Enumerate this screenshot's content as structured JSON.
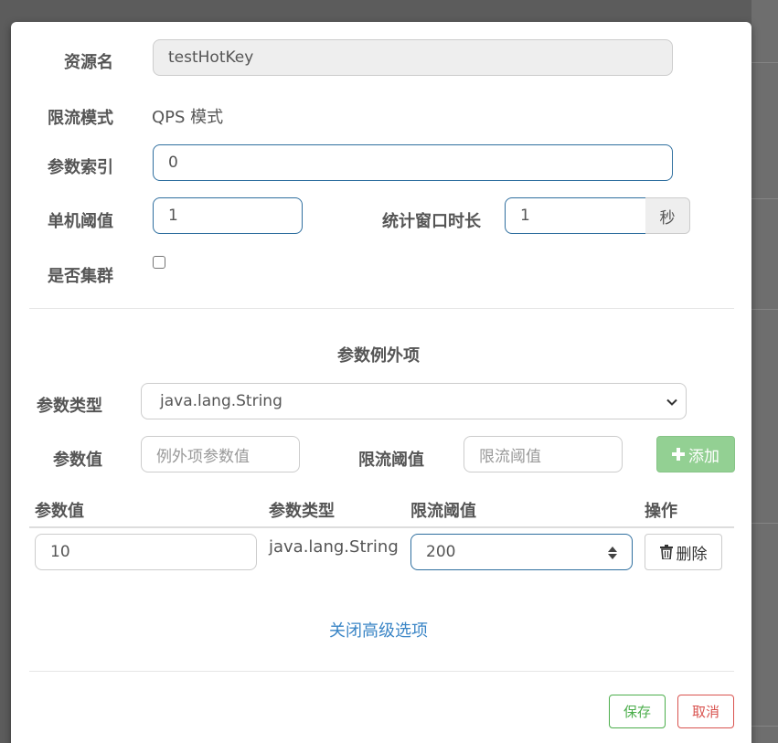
{
  "form": {
    "resource_label": "资源名",
    "resource_value": "testHotKey",
    "mode_label": "限流模式",
    "mode_value": "QPS 模式",
    "param_index_label": "参数索引",
    "param_index_value": "0",
    "single_threshold_label": "单机阈值",
    "single_threshold_value": "1",
    "window_label": "统计窗口时长",
    "window_value": "1",
    "window_unit": "秒",
    "cluster_label": "是否集群",
    "cluster_checked": false
  },
  "exception": {
    "section_title": "参数例外项",
    "type_label": "参数类型",
    "type_selected": "java.lang.String",
    "value_label": "参数值",
    "value_placeholder": "例外项参数值",
    "threshold_label": "限流阈值",
    "threshold_placeholder": "限流阈值",
    "add_button": "添加",
    "table": {
      "headers": [
        "参数值",
        "参数类型",
        "限流阈值",
        "操作"
      ],
      "rows": [
        {
          "value": "10",
          "type": "java.lang.String",
          "threshold": "200",
          "action": "删除"
        }
      ]
    }
  },
  "toggle_link": "关闭高级选项",
  "footer": {
    "save": "保存",
    "cancel": "取消"
  },
  "colors": {
    "focus_border": "#2f6f9f",
    "add_button_bg": "#93d093",
    "save": "#4cae4c",
    "cancel": "#d9534f",
    "link": "#3a85c6"
  },
  "icons": [
    "chevron-down-icon",
    "plus-icon",
    "trash-icon",
    "spinner-arrows-icon"
  ]
}
